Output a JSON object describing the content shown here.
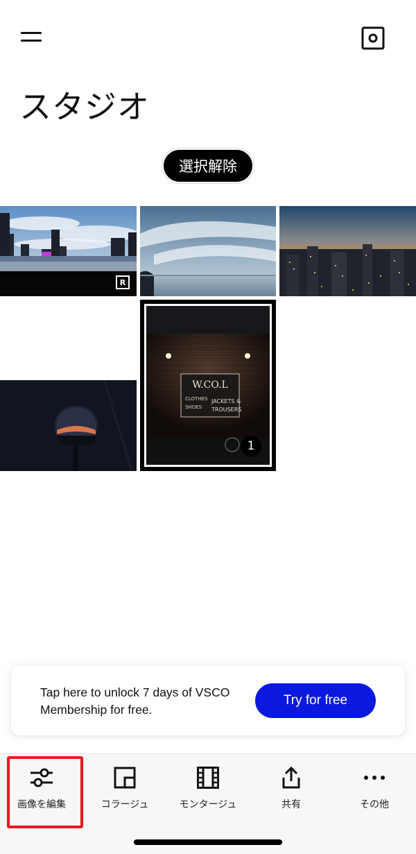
{
  "header": {
    "title": "スタジオ"
  },
  "actions": {
    "deselect_label": "選択解除"
  },
  "grid": {
    "raw_badge": "R",
    "selected_count": "1",
    "sign_text": {
      "title": "W.CO.L",
      "left_lines": [
        "CLOTHES",
        "SHOES"
      ],
      "right_lines": [
        "JACKETS &",
        "TROUSERS"
      ]
    }
  },
  "promo": {
    "text": "Tap here to unlock 7 days of VSCO Membership for free.",
    "button_label": "Try for free",
    "button_color": "#0a18e0"
  },
  "toolbar": {
    "items": [
      {
        "label": "画像を編集",
        "icon": "sliders-icon"
      },
      {
        "label": "コラージュ",
        "icon": "collage-icon"
      },
      {
        "label": "モンタージュ",
        "icon": "film-icon"
      },
      {
        "label": "共有",
        "icon": "share-icon"
      },
      {
        "label": "その他",
        "icon": "more-icon"
      }
    ],
    "highlight_color": "#e8191f"
  }
}
